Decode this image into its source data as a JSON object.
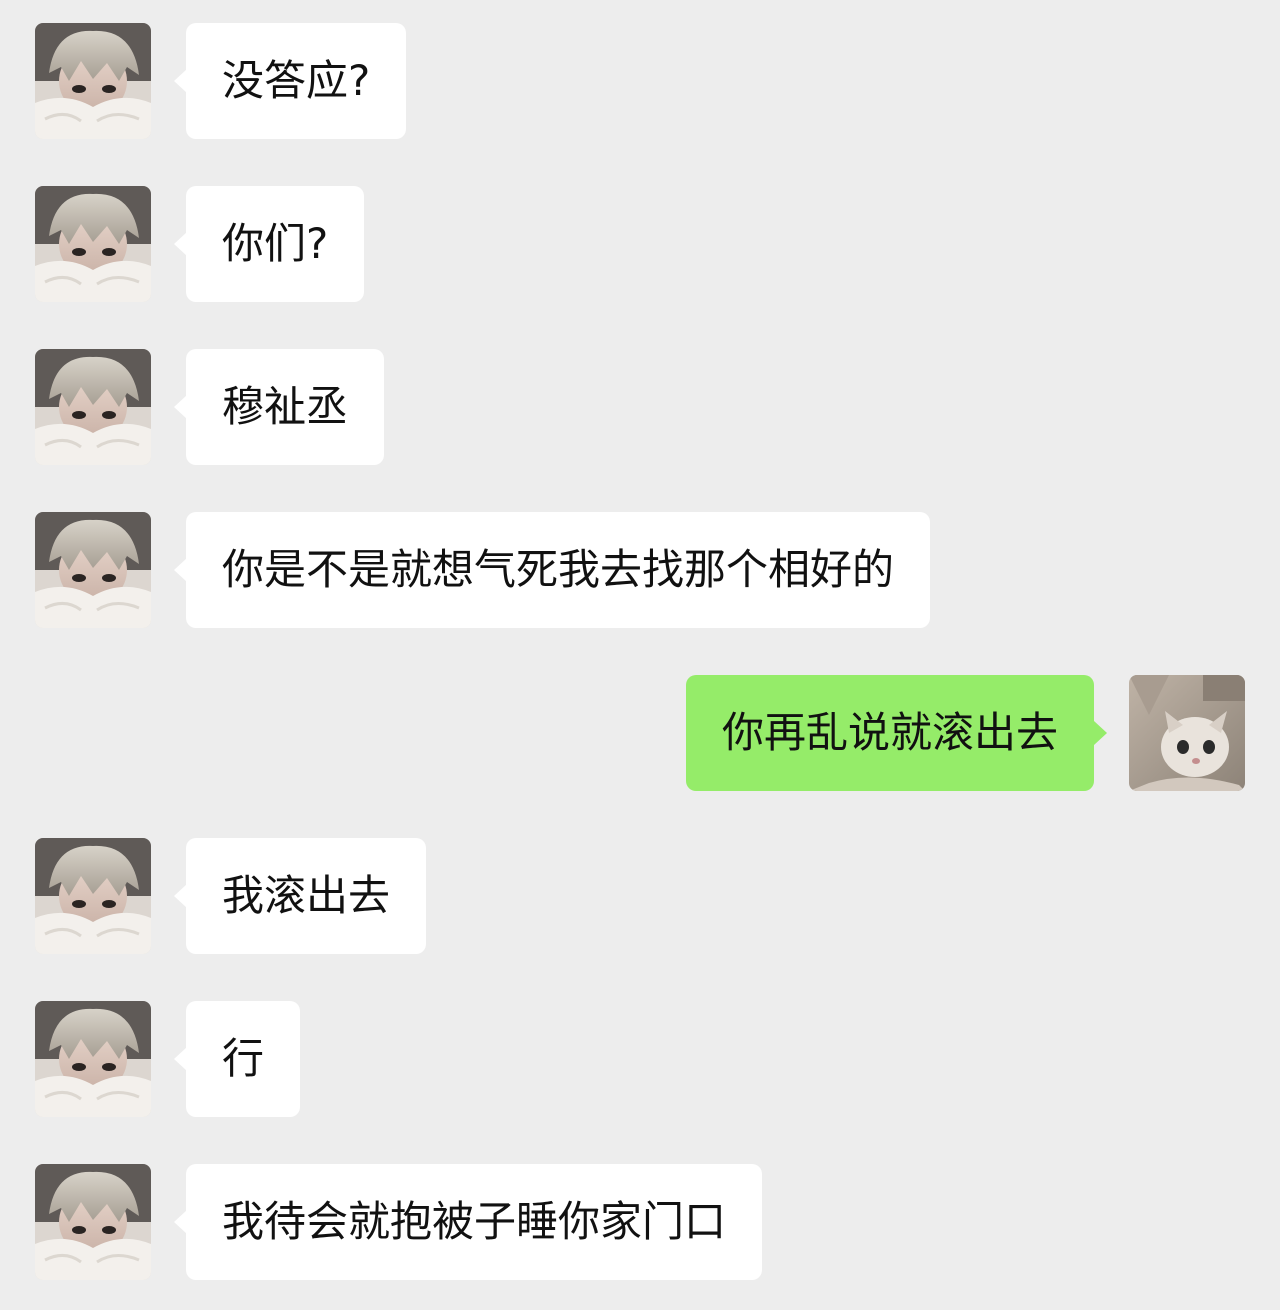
{
  "chat": {
    "messages": [
      {
        "side": "in",
        "text": "没答应?"
      },
      {
        "side": "in",
        "text": "你们?"
      },
      {
        "side": "in",
        "text": "穆祉丞"
      },
      {
        "side": "in",
        "text": "你是不是就想气死我去找那个相好的"
      },
      {
        "side": "out",
        "text": "你再乱说就滚出去"
      },
      {
        "side": "in",
        "text": "我滚出去"
      },
      {
        "side": "in",
        "text": "行"
      },
      {
        "side": "in",
        "text": "我待会就抱被子睡你家门口"
      }
    ]
  },
  "colors": {
    "background": "#ededed",
    "incoming_bubble": "#ffffff",
    "outgoing_bubble": "#95ec69",
    "text": "#111111"
  },
  "icons": {
    "contact_avatar": "person-photo-avatar",
    "self_avatar": "cat-photo-avatar"
  }
}
